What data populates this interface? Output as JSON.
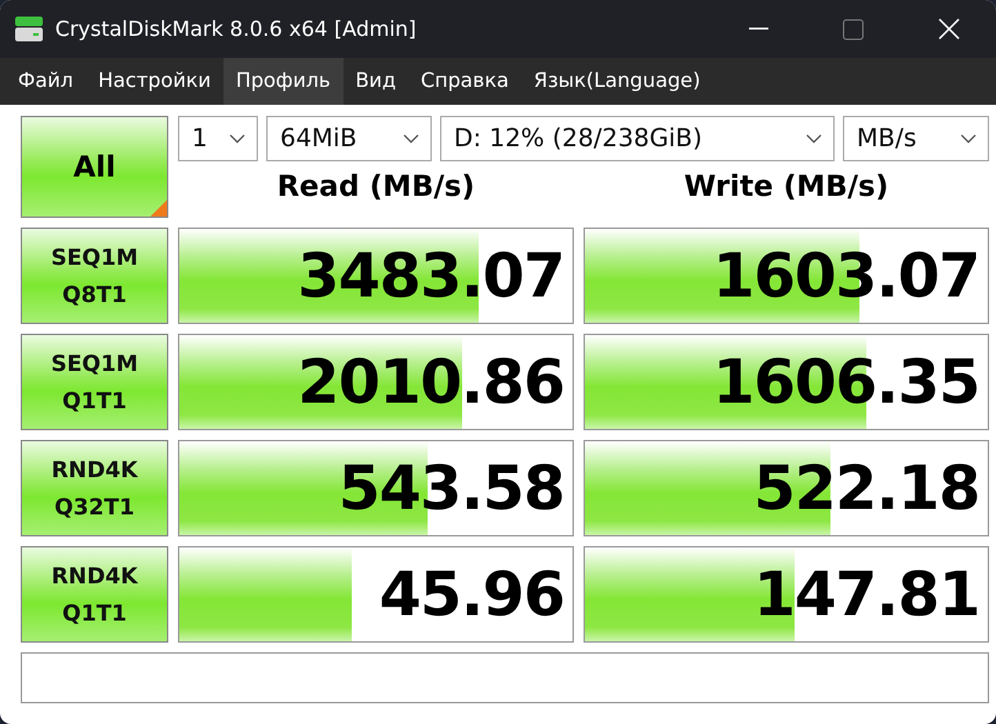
{
  "window": {
    "title": "CrystalDiskMark 8.0.6 x64 [Admin]"
  },
  "menu": [
    {
      "label": "Файл",
      "selected": false
    },
    {
      "label": "Настройки",
      "selected": false
    },
    {
      "label": "Профиль",
      "selected": true
    },
    {
      "label": "Вид",
      "selected": false
    },
    {
      "label": "Справка",
      "selected": false
    },
    {
      "label": "Язык(Language)",
      "selected": false
    }
  ],
  "all_button": {
    "label": "All"
  },
  "selectors": [
    {
      "value": "1"
    },
    {
      "value": "64MiB"
    },
    {
      "value": "D: 12% (28/238GiB)"
    },
    {
      "value": "MB/s"
    }
  ],
  "columns": [
    "Read (MB/s)",
    "Write (MB/s)"
  ],
  "tests": [
    {
      "line1": "SEQ1M",
      "line2": "Q8T1",
      "read": {
        "value": "3483.07",
        "level": 0.76
      },
      "write": {
        "value": "1603.07",
        "level": 0.68
      }
    },
    {
      "line1": "SEQ1M",
      "line2": "Q1T1",
      "read": {
        "value": "2010.86",
        "level": 0.72
      },
      "write": {
        "value": "1606.35",
        "level": 0.7
      }
    },
    {
      "line1": "RND4K",
      "line2": "Q32T1",
      "read": {
        "value": "543.58",
        "level": 0.63
      },
      "write": {
        "value": "522.18",
        "level": 0.61
      }
    },
    {
      "line1": "RND4K",
      "line2": "Q1T1",
      "read": {
        "value": "45.96",
        "level": 0.44
      },
      "write": {
        "value": "147.81",
        "level": 0.52
      }
    }
  ]
}
